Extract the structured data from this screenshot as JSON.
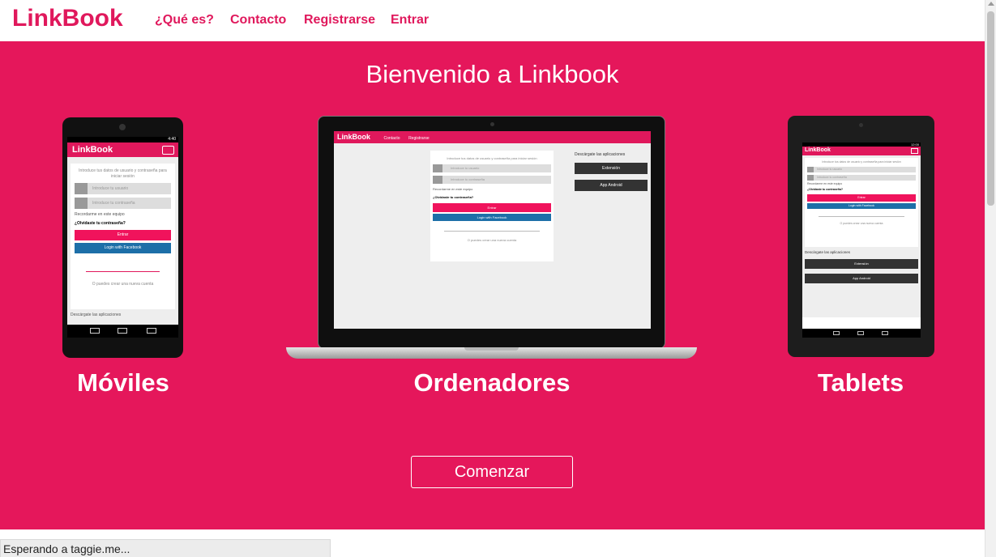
{
  "nav": {
    "brand": "LinkBook",
    "links": [
      "¿Qué es?",
      "Contacto",
      "Registrarse",
      "Entrar"
    ]
  },
  "hero": {
    "title": "Bienvenido a Linkbook",
    "devices": [
      "Móviles",
      "Ordenadores",
      "Tablets"
    ],
    "cta": "Comenzar"
  },
  "mockup": {
    "brand": "LinkBook",
    "nav_links": [
      "Contacto",
      "Registrarse"
    ],
    "intro": "Introduce tus datos de usuario y contraseña para iniciar sesión",
    "username_placeholder": "Introduce tu usuario",
    "password_placeholder": "Introduce tu contraseña",
    "remember": "Recordarme en este equipo",
    "forgot": "¿Olvidaste tu contraseña?",
    "login_button": "Entrar",
    "facebook_button": "Login with Facebook",
    "signup_text": "O puedes crear una nueva cuenta",
    "apps_title": "Descárgate las aplicaciones",
    "extension_button": "Extensión",
    "android_button": "App Android",
    "phone_time": "4:40",
    "tablet_time": "12:00"
  },
  "statusbar": {
    "text": "Esperando a taggie.me..."
  }
}
